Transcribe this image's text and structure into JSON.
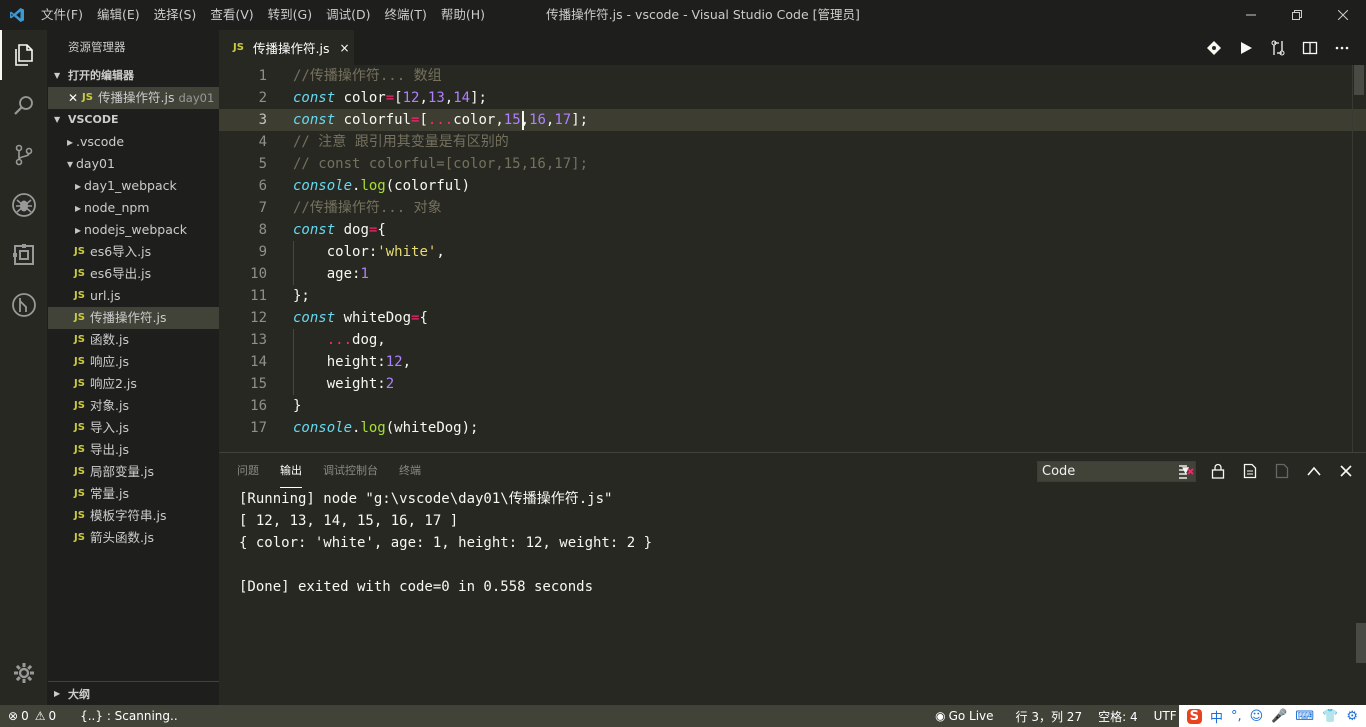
{
  "titlebar": {
    "menus": [
      "文件(F)",
      "编辑(E)",
      "选择(S)",
      "查看(V)",
      "转到(G)",
      "调试(D)",
      "终端(T)",
      "帮助(H)"
    ],
    "window_title": "传播操作符.js - vscode - Visual Studio Code [管理员]"
  },
  "sidebar": {
    "title": "资源管理器",
    "open_editors_label": "打开的编辑器",
    "open_editor": {
      "icon_text": "JS",
      "name": "传播操作符.js",
      "folder": "day01"
    },
    "workspace_label": "VSCODE",
    "tree": [
      {
        "label": ".vscode",
        "type": "folder-collapsed",
        "depth": 1
      },
      {
        "label": "day01",
        "type": "folder-expanded",
        "depth": 1
      },
      {
        "label": "day1_webpack",
        "type": "folder-collapsed",
        "depth": 2
      },
      {
        "label": "node_npm",
        "type": "folder-collapsed",
        "depth": 2
      },
      {
        "label": "nodejs_webpack",
        "type": "folder-collapsed",
        "depth": 2
      },
      {
        "label": "es6导入.js",
        "type": "js",
        "depth": 2
      },
      {
        "label": "es6导出.js",
        "type": "js",
        "depth": 2
      },
      {
        "label": "url.js",
        "type": "js",
        "depth": 2
      },
      {
        "label": "传播操作符.js",
        "type": "js",
        "depth": 2,
        "selected": true
      },
      {
        "label": "函数.js",
        "type": "js",
        "depth": 2
      },
      {
        "label": "响应.js",
        "type": "js",
        "depth": 2
      },
      {
        "label": "响应2.js",
        "type": "js",
        "depth": 2
      },
      {
        "label": "对象.js",
        "type": "js",
        "depth": 2
      },
      {
        "label": "导入.js",
        "type": "js",
        "depth": 2
      },
      {
        "label": "导出.js",
        "type": "js",
        "depth": 2
      },
      {
        "label": "局部变量.js",
        "type": "js",
        "depth": 2
      },
      {
        "label": "常量.js",
        "type": "js",
        "depth": 2
      },
      {
        "label": "模板字符串.js",
        "type": "js",
        "depth": 2
      },
      {
        "label": "箭头函数.js",
        "type": "js",
        "depth": 2
      }
    ],
    "outline_label": "大纲",
    "js_icon_text": "JS"
  },
  "tab": {
    "icon_text": "JS",
    "label": "传播操作符.js",
    "close": "×"
  },
  "editor": {
    "current_line": 3,
    "lines": [
      [
        [
          "cm",
          "//传播操作符... 数组"
        ]
      ],
      [
        [
          "kw",
          "const"
        ],
        [
          "t",
          " color"
        ],
        [
          "op",
          "="
        ],
        [
          "t",
          "["
        ],
        [
          "num",
          "12"
        ],
        [
          "t",
          ","
        ],
        [
          "num",
          "13"
        ],
        [
          "t",
          ","
        ],
        [
          "num",
          "14"
        ],
        [
          "t",
          "];"
        ]
      ],
      [
        [
          "kw",
          "const"
        ],
        [
          "t",
          " colorful"
        ],
        [
          "op",
          "="
        ],
        [
          "t",
          "["
        ],
        [
          "op",
          "..."
        ],
        [
          "t",
          "color,"
        ],
        [
          "num",
          "15"
        ],
        [
          "t",
          ","
        ],
        [
          "num",
          "16"
        ],
        [
          "t",
          ","
        ],
        [
          "num",
          "17"
        ],
        [
          "t",
          "];"
        ]
      ],
      [
        [
          "cm",
          "// 注意 跟引用其变量是有区别的"
        ]
      ],
      [
        [
          "cm",
          "// const colorful=[color,15,16,17];"
        ]
      ],
      [
        [
          "kw",
          "console"
        ],
        [
          "t",
          "."
        ],
        [
          "fn",
          "log"
        ],
        [
          "t",
          "(colorful)"
        ]
      ],
      [
        [
          "cm",
          "//传播操作符... 对象"
        ]
      ],
      [
        [
          "kw",
          "const"
        ],
        [
          "t",
          " dog"
        ],
        [
          "op",
          "="
        ],
        [
          "t",
          "{"
        ]
      ],
      [
        [
          "t",
          "    color:"
        ],
        [
          "str",
          "'white'"
        ],
        [
          "t",
          ","
        ]
      ],
      [
        [
          "t",
          "    age:"
        ],
        [
          "num",
          "1"
        ]
      ],
      [
        [
          "t",
          "};"
        ]
      ],
      [
        [
          "kw",
          "const"
        ],
        [
          "t",
          " whiteDog"
        ],
        [
          "op",
          "="
        ],
        [
          "t",
          "{"
        ]
      ],
      [
        [
          "t",
          "    "
        ],
        [
          "op",
          "..."
        ],
        [
          "t",
          "dog,"
        ]
      ],
      [
        [
          "t",
          "    height:"
        ],
        [
          "num",
          "12"
        ],
        [
          "t",
          ","
        ]
      ],
      [
        [
          "t",
          "    weight:"
        ],
        [
          "num",
          "2"
        ]
      ],
      [
        [
          "t",
          "}"
        ]
      ],
      [
        [
          "kw",
          "console"
        ],
        [
          "t",
          "."
        ],
        [
          "fn",
          "log"
        ],
        [
          "t",
          "(whiteDog);"
        ]
      ]
    ]
  },
  "panel": {
    "tabs": [
      "问题",
      "输出",
      "调试控制台",
      "终端"
    ],
    "active_tab": "输出",
    "channel": "Code",
    "output": [
      "[Running] node \"g:\\vscode\\day01\\传播操作符.js\"",
      "[ 12, 13, 14, 15, 16, 17 ]",
      "{ color: 'white', age: 1, height: 12, weight: 2 }",
      "",
      "[Done] exited with code=0 in 0.558 seconds"
    ]
  },
  "statusbar": {
    "errors": "0",
    "warnings": "0",
    "scanning": "{..} : Scanning..",
    "golive": "Go Live",
    "position": "行 3，列 27",
    "spaces": "空格: 4",
    "encoding": "UTF",
    "ime": [
      "中",
      "°,",
      "☺",
      "🎤",
      "⌨",
      "👕",
      "⚙"
    ]
  },
  "colors": {
    "editor_bg": "#272822",
    "sidebar_bg": "#1e1f1c",
    "statusbar_bg": "#414339",
    "keyword": "#66d9ef",
    "number": "#ae81ff",
    "operator": "#f92672",
    "string": "#e6db74",
    "comment": "#75715e",
    "function": "#a6e22e"
  }
}
